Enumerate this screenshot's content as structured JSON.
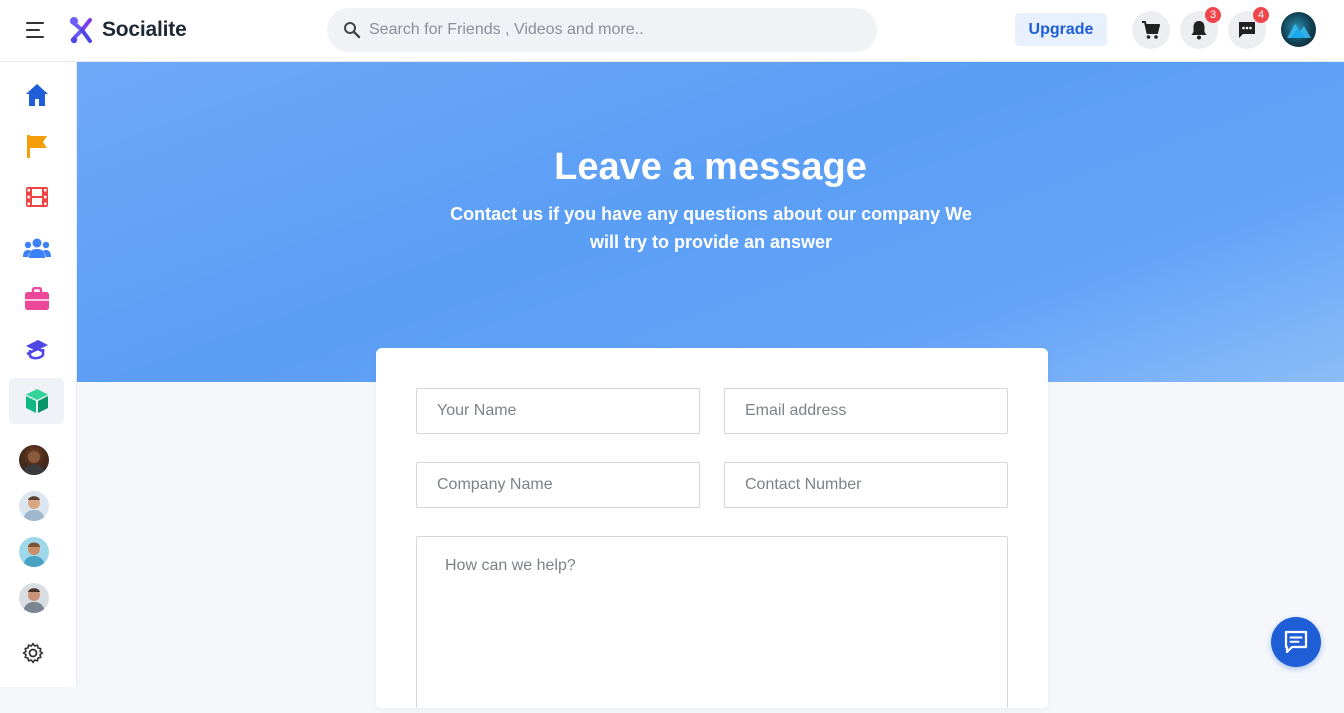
{
  "header": {
    "brand": "Socialite",
    "search_placeholder": "Search for Friends , Videos and more..",
    "upgrade_label": "Upgrade",
    "notifications_count": "3",
    "messages_count": "4"
  },
  "sidebar": {
    "items": [
      {
        "name": "home",
        "color": "#1e5fd8"
      },
      {
        "name": "pages",
        "color": "#f59e0b"
      },
      {
        "name": "videos",
        "color": "#ef4444"
      },
      {
        "name": "groups",
        "color": "#3b82f6"
      },
      {
        "name": "jobs",
        "color": "#ec4899"
      },
      {
        "name": "courses",
        "color": "#4f46e5"
      },
      {
        "name": "products",
        "color": "#10b981",
        "active": true
      }
    ]
  },
  "hero": {
    "title": "Leave a message",
    "subtitle": "Contact us if you have any questions about our company We will try to provide an answer"
  },
  "form": {
    "name_placeholder": "Your Name",
    "email_placeholder": "Email address",
    "company_placeholder": "Company Name",
    "phone_placeholder": "Contact Number",
    "message_placeholder": "How can we help?"
  },
  "colors": {
    "accent": "#1e5fd8",
    "hero_bg": "#5a9ef5",
    "badge": "#f0474f"
  }
}
